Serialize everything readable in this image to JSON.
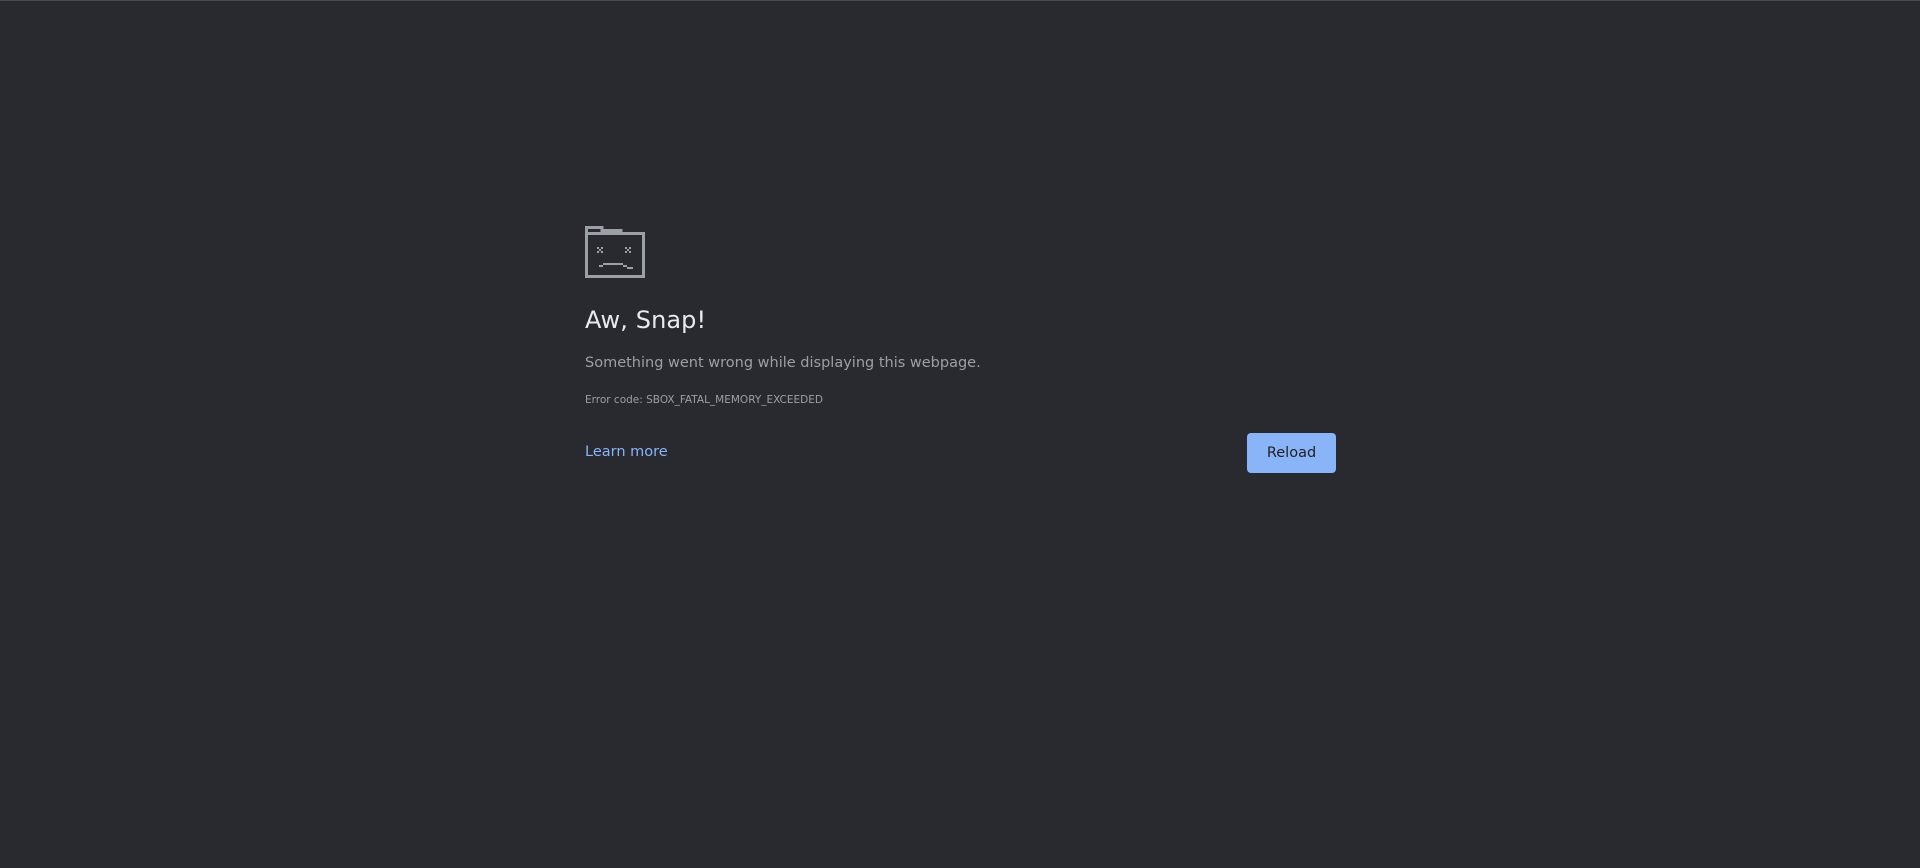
{
  "error_page": {
    "icon": "sad-tab-icon",
    "title": "Aw, Snap!",
    "message": "Something went wrong while displaying this webpage.",
    "error_code": "Error code: SBOX_FATAL_MEMORY_EXCEEDED",
    "learn_more_label": "Learn more",
    "reload_label": "Reload"
  },
  "colors": {
    "background": "#292a2f",
    "title_text": "#e8eaed",
    "secondary_text": "#9aa0a6",
    "link": "#8ab4f8",
    "button_bg": "#8ab4f8",
    "button_text": "#202124"
  }
}
